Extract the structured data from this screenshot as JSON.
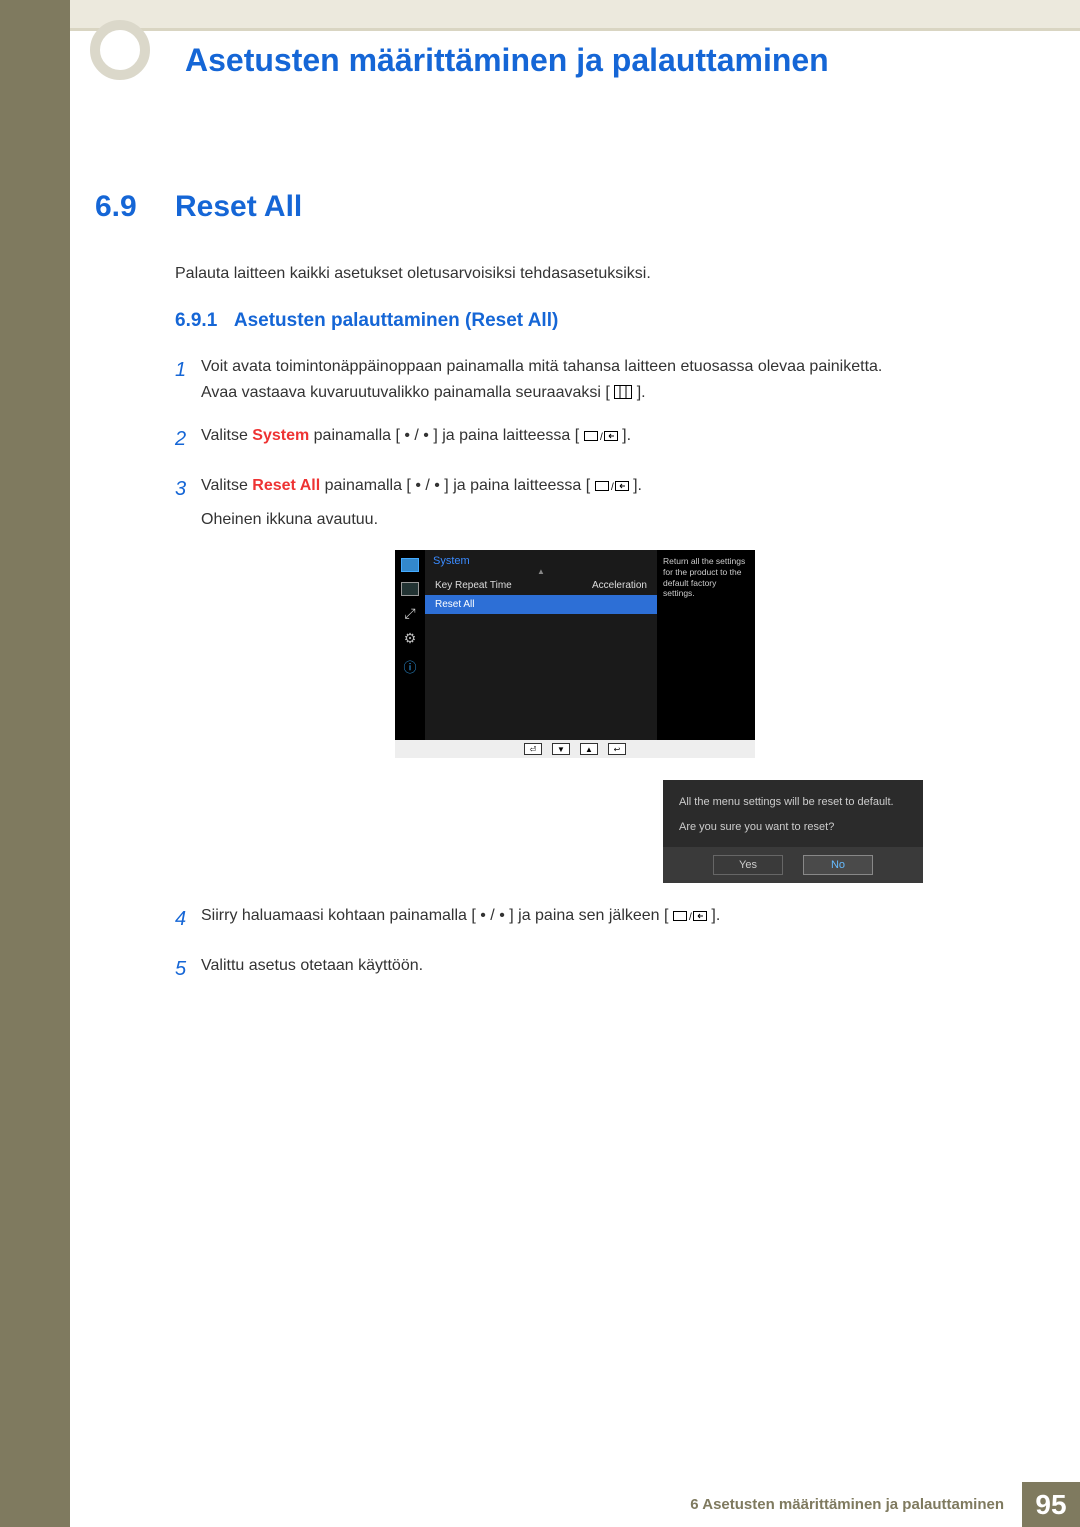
{
  "chapter_title": "Asetusten määrittäminen ja palauttaminen",
  "section": {
    "number": "6.9",
    "title": "Reset All",
    "intro": "Palauta laitteen kaikki asetukset oletusarvoisiksi tehdasasetuksiksi."
  },
  "subsection": {
    "number": "6.9.1",
    "title": "Asetusten palauttaminen (Reset All)"
  },
  "steps": {
    "s1": {
      "n": "1",
      "line1": "Voit avata toimintonäppäinoppaan painamalla mitä tahansa laitteen etuosassa olevaa painiketta.",
      "line2_pre": "Avaa vastaava kuvaruutuvalikko painamalla seuraavaksi [",
      "line2_post": "]."
    },
    "s2": {
      "n": "2",
      "pre": "Valitse ",
      "hl": "System",
      "mid": " painamalla [ • / • ] ja paina laitteessa [",
      "post": "]."
    },
    "s3": {
      "n": "3",
      "pre": "Valitse ",
      "hl": "Reset All",
      "mid": " painamalla [ • / • ] ja paina laitteessa [",
      "post": "].",
      "after": "Oheinen ikkuna avautuu."
    },
    "s4": {
      "n": "4",
      "pre": "Siirry haluamaasi kohtaan painamalla [ • / • ] ja paina sen jälkeen [",
      "post": "]."
    },
    "s5": {
      "n": "5",
      "text": "Valittu asetus otetaan käyttöön."
    }
  },
  "osd": {
    "menu_title": "System",
    "item1_label": "Key Repeat Time",
    "item1_value": "Acceleration",
    "item2_label": "Reset All",
    "help_text": "Return all the settings for the product to the default factory settings."
  },
  "dialog": {
    "line1": "All the menu settings will be reset to default.",
    "line2": "Are you sure you want to reset?",
    "yes": "Yes",
    "no": "No"
  },
  "footer": {
    "chapter_label": "6 Asetusten määrittäminen ja palauttaminen",
    "page": "95"
  }
}
